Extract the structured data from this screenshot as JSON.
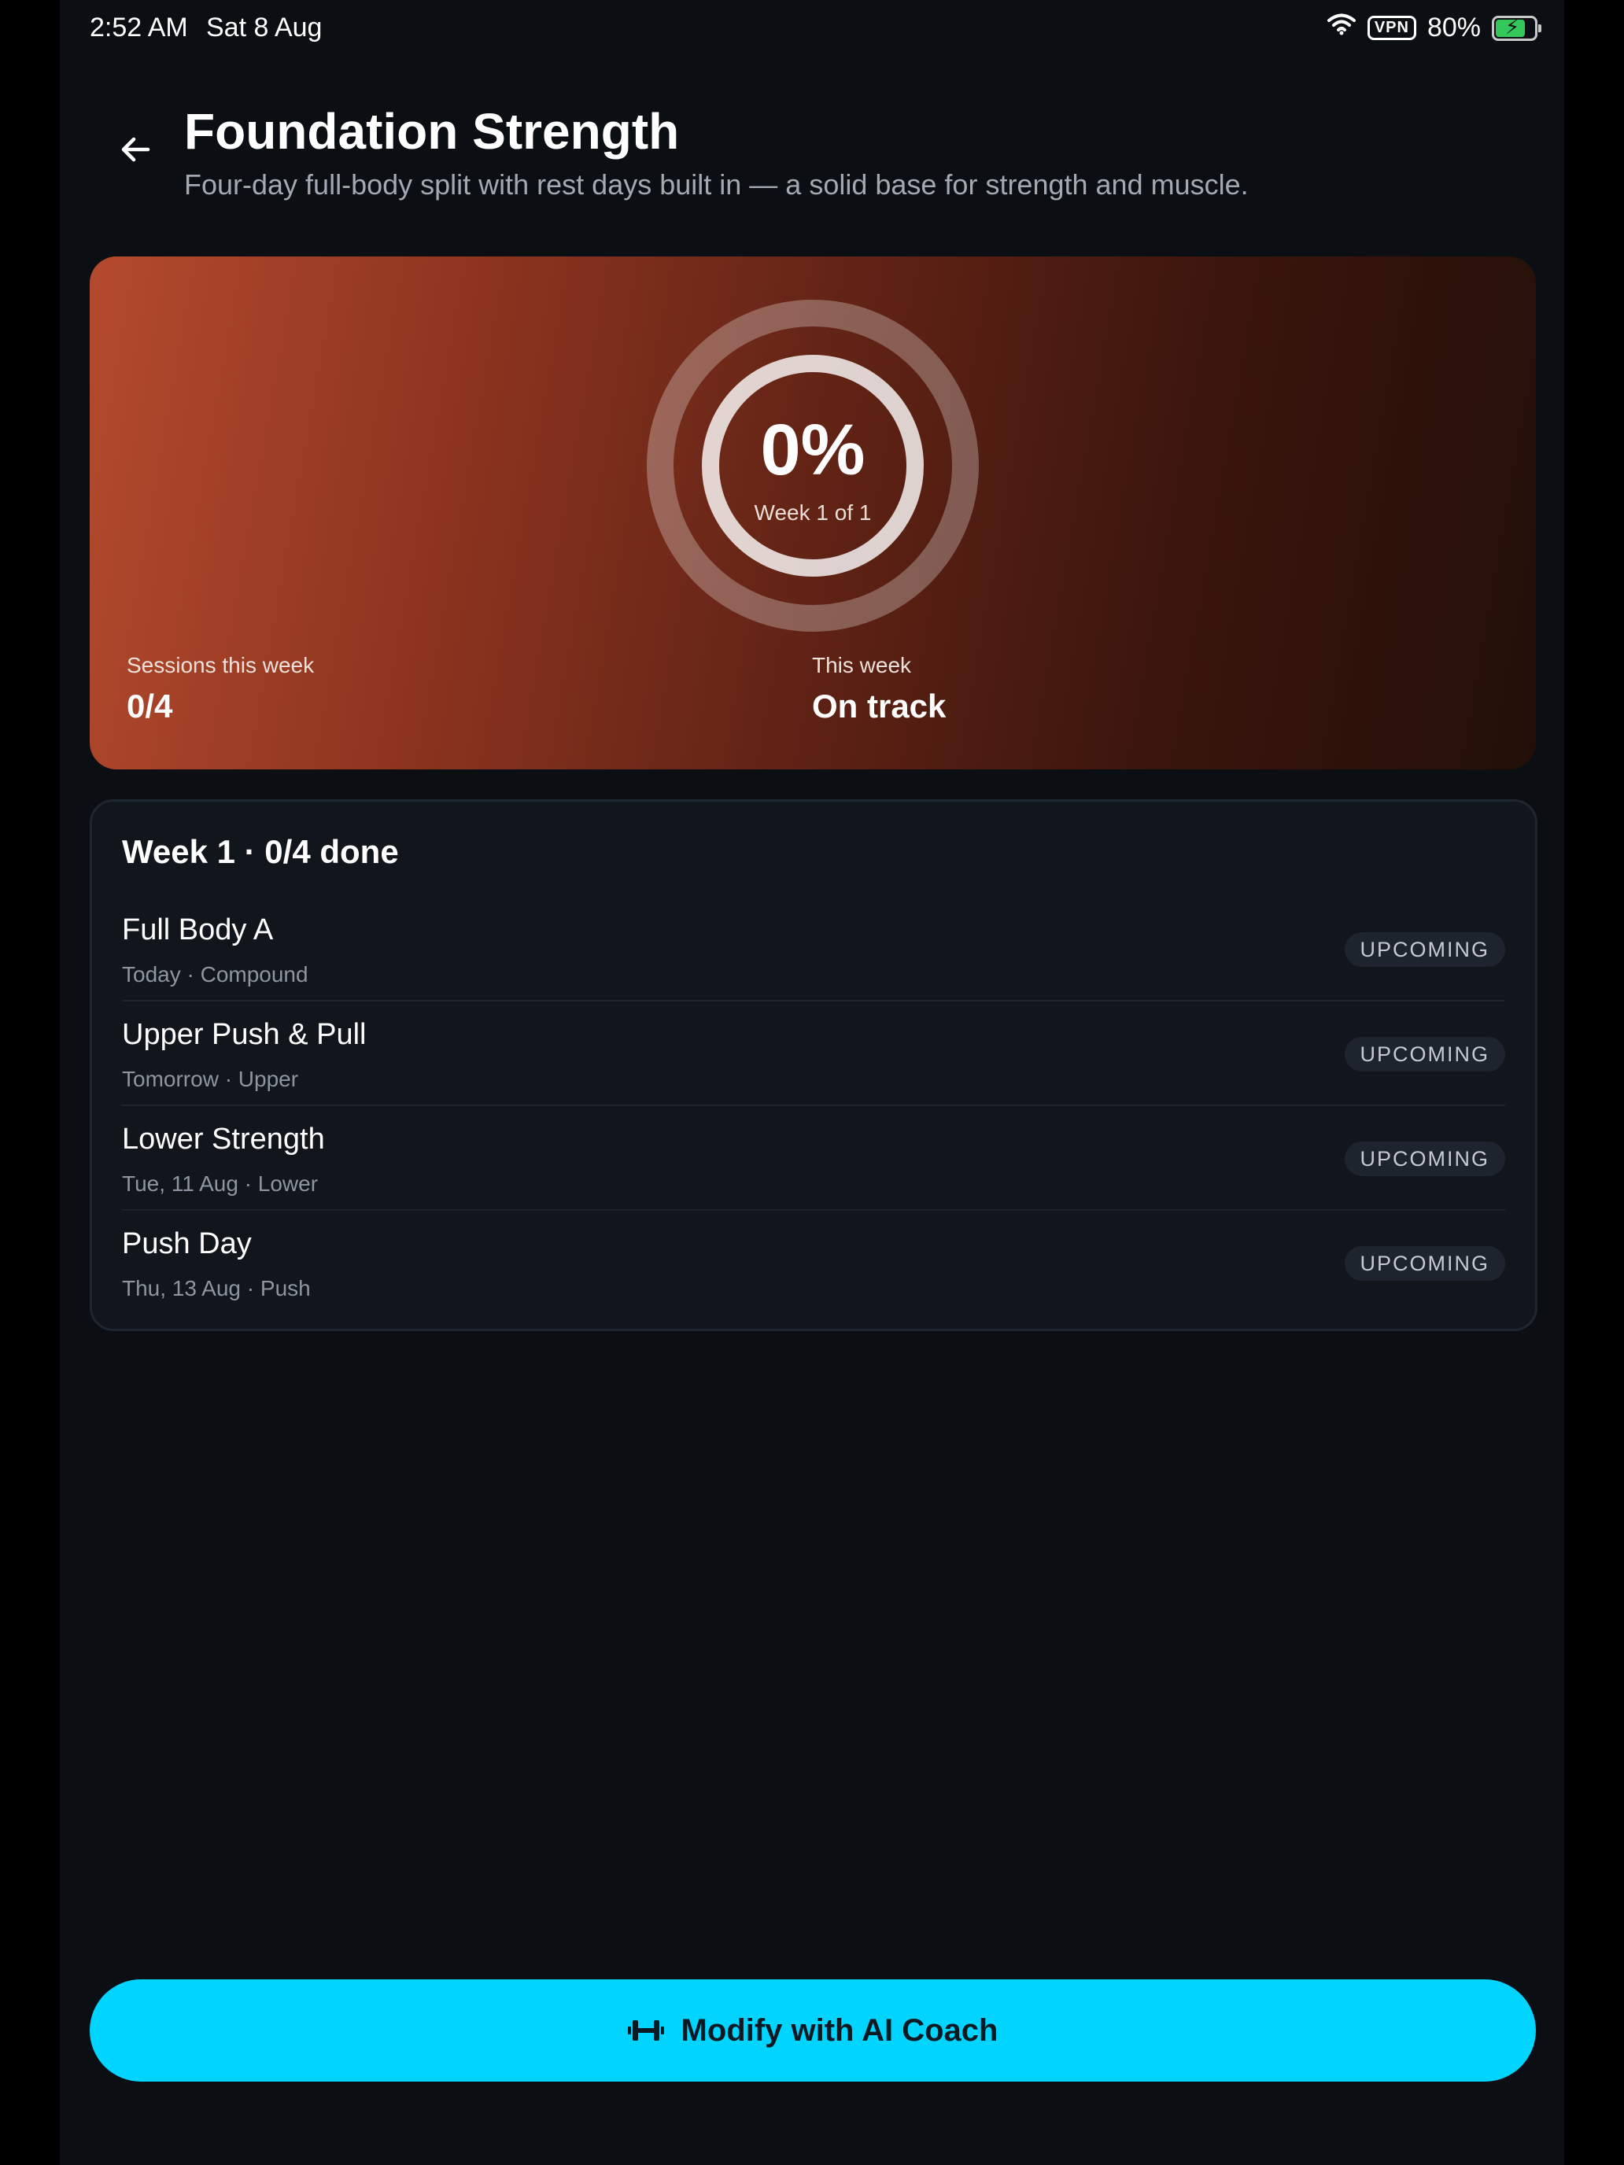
{
  "status_bar": {
    "time": "2:52 AM",
    "date": "Sat 8 Aug",
    "vpn": "VPN",
    "battery": "80%",
    "battery_level": 0.8,
    "icons": [
      "wifi-icon",
      "battery-charging-icon"
    ]
  },
  "header": {
    "back_icon": "arrow-left-icon",
    "title": "Foundation Strength",
    "subtitle": "Four-day full-body split with rest days built in — a solid base for strength and muscle."
  },
  "progress": {
    "percent_label": "0%",
    "percent_value": 0,
    "week_label": "Week 1 of 1",
    "sessions_label": "Sessions this week",
    "sessions_value": "0/4",
    "status_label": "This week",
    "status_value": "On track"
  },
  "week": {
    "title": "Week 1 · 0/4 done",
    "sessions": [
      {
        "name": "Full Body A",
        "meta": "Today · Compound",
        "status": "UPCOMING"
      },
      {
        "name": "Upper Push & Pull",
        "meta": "Tomorrow · Upper",
        "status": "UPCOMING"
      },
      {
        "name": "Lower Strength",
        "meta": "Tue, 11 Aug · Lower",
        "status": "UPCOMING"
      },
      {
        "name": "Push Day",
        "meta": "Thu, 13 Aug · Push",
        "status": "UPCOMING"
      }
    ]
  },
  "cta": {
    "icon": "dumbbell-icon",
    "label": "Modify with AI Coach"
  },
  "colors": {
    "background": "#0b0e13",
    "accent": "#00d4ff",
    "hero_start": "#b44a2d",
    "hero_end": "#221008",
    "card": "#11161d",
    "battery_green": "#34c759"
  }
}
